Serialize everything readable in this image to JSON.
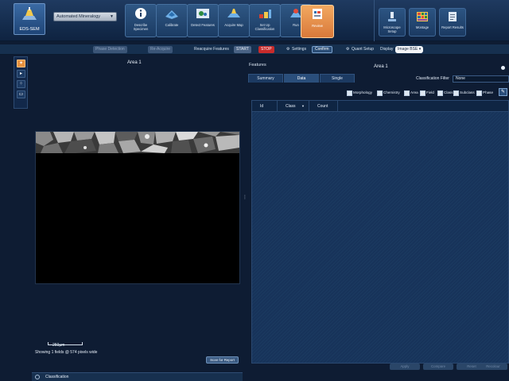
{
  "app": {
    "tile_label": "EDS-SEM",
    "mode": "Automated Mineralogy"
  },
  "steps": [
    {
      "label": "Describe Specimen",
      "icon": "info-icon"
    },
    {
      "label": "Calibrate",
      "icon": "calibrate-icon"
    },
    {
      "label": "Detect Features",
      "icon": "detect-features-icon"
    },
    {
      "label": "Acquire Map",
      "icon": "acquire-map-icon"
    },
    {
      "label": "Set Up Classification",
      "icon": "classification-icon"
    },
    {
      "label": "Run",
      "icon": "run-icon"
    },
    {
      "label": "Review",
      "icon": "review-icon"
    }
  ],
  "tools": [
    {
      "label": "Microscope Setup",
      "icon": "microscope-icon"
    },
    {
      "label": "Montage",
      "icon": "montage-icon"
    },
    {
      "label": "Report Results",
      "icon": "report-icon"
    }
  ],
  "toolbar": {
    "grayed_1": "Phase Detection",
    "grayed_2": "Re-Acquire",
    "reacquire_label": "Reacquire Features",
    "start_label": "START",
    "stop_label": "STOP",
    "settings_label": "Settings",
    "confirm_label": "Confirm",
    "quant_label": "Quant Setup",
    "display_label": "Display",
    "display_value": "Image BSE"
  },
  "left_panel": {
    "title": "Area 1",
    "scale_label": "250µm",
    "showing_text": "Showing 1 fields @ 574 pixels wide",
    "scan_button": "Scan for Report",
    "classification_label": "Classification"
  },
  "right_panel": {
    "features_label": "Features",
    "title": "Area 1",
    "tabs": [
      "Summary",
      "Data",
      "Single"
    ],
    "active_tab": "Data",
    "filter_label": "Classification Filter",
    "filter_value": "None",
    "chips": [
      "Morphology",
      "Chemistry",
      "Area",
      "Field",
      "Class",
      "Subclass",
      "Phase"
    ],
    "columns": [
      "Id",
      "Class",
      "Count"
    ],
    "bottom_buttons": [
      "Apply",
      "Compare",
      "Reset",
      "Recolour"
    ]
  },
  "colors": {
    "accent_orange": "#e8913f",
    "stop_red": "#c82b2b",
    "panel_bg": "#153050"
  }
}
